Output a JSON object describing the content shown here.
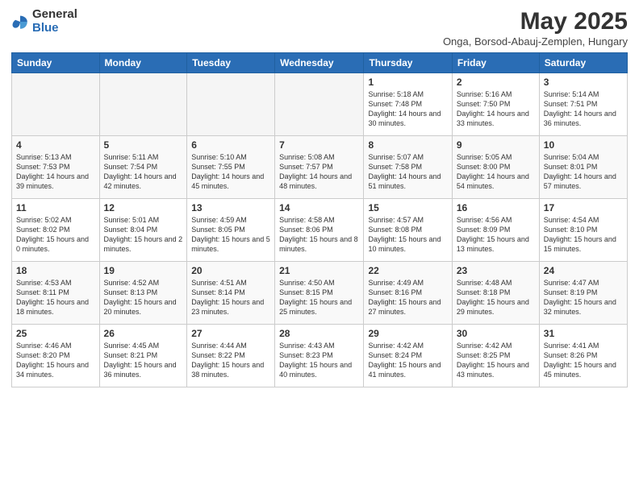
{
  "logo": {
    "general": "General",
    "blue": "Blue"
  },
  "title": "May 2025",
  "subtitle": "Onga, Borsod-Abauj-Zemplen, Hungary",
  "headers": [
    "Sunday",
    "Monday",
    "Tuesday",
    "Wednesday",
    "Thursday",
    "Friday",
    "Saturday"
  ],
  "weeks": [
    [
      {
        "day": "",
        "info": ""
      },
      {
        "day": "",
        "info": ""
      },
      {
        "day": "",
        "info": ""
      },
      {
        "day": "",
        "info": ""
      },
      {
        "day": "1",
        "info": "Sunrise: 5:18 AM\nSunset: 7:48 PM\nDaylight: 14 hours\nand 30 minutes."
      },
      {
        "day": "2",
        "info": "Sunrise: 5:16 AM\nSunset: 7:50 PM\nDaylight: 14 hours\nand 33 minutes."
      },
      {
        "day": "3",
        "info": "Sunrise: 5:14 AM\nSunset: 7:51 PM\nDaylight: 14 hours\nand 36 minutes."
      }
    ],
    [
      {
        "day": "4",
        "info": "Sunrise: 5:13 AM\nSunset: 7:53 PM\nDaylight: 14 hours\nand 39 minutes."
      },
      {
        "day": "5",
        "info": "Sunrise: 5:11 AM\nSunset: 7:54 PM\nDaylight: 14 hours\nand 42 minutes."
      },
      {
        "day": "6",
        "info": "Sunrise: 5:10 AM\nSunset: 7:55 PM\nDaylight: 14 hours\nand 45 minutes."
      },
      {
        "day": "7",
        "info": "Sunrise: 5:08 AM\nSunset: 7:57 PM\nDaylight: 14 hours\nand 48 minutes."
      },
      {
        "day": "8",
        "info": "Sunrise: 5:07 AM\nSunset: 7:58 PM\nDaylight: 14 hours\nand 51 minutes."
      },
      {
        "day": "9",
        "info": "Sunrise: 5:05 AM\nSunset: 8:00 PM\nDaylight: 14 hours\nand 54 minutes."
      },
      {
        "day": "10",
        "info": "Sunrise: 5:04 AM\nSunset: 8:01 PM\nDaylight: 14 hours\nand 57 minutes."
      }
    ],
    [
      {
        "day": "11",
        "info": "Sunrise: 5:02 AM\nSunset: 8:02 PM\nDaylight: 15 hours\nand 0 minutes."
      },
      {
        "day": "12",
        "info": "Sunrise: 5:01 AM\nSunset: 8:04 PM\nDaylight: 15 hours\nand 2 minutes."
      },
      {
        "day": "13",
        "info": "Sunrise: 4:59 AM\nSunset: 8:05 PM\nDaylight: 15 hours\nand 5 minutes."
      },
      {
        "day": "14",
        "info": "Sunrise: 4:58 AM\nSunset: 8:06 PM\nDaylight: 15 hours\nand 8 minutes."
      },
      {
        "day": "15",
        "info": "Sunrise: 4:57 AM\nSunset: 8:08 PM\nDaylight: 15 hours\nand 10 minutes."
      },
      {
        "day": "16",
        "info": "Sunrise: 4:56 AM\nSunset: 8:09 PM\nDaylight: 15 hours\nand 13 minutes."
      },
      {
        "day": "17",
        "info": "Sunrise: 4:54 AM\nSunset: 8:10 PM\nDaylight: 15 hours\nand 15 minutes."
      }
    ],
    [
      {
        "day": "18",
        "info": "Sunrise: 4:53 AM\nSunset: 8:11 PM\nDaylight: 15 hours\nand 18 minutes."
      },
      {
        "day": "19",
        "info": "Sunrise: 4:52 AM\nSunset: 8:13 PM\nDaylight: 15 hours\nand 20 minutes."
      },
      {
        "day": "20",
        "info": "Sunrise: 4:51 AM\nSunset: 8:14 PM\nDaylight: 15 hours\nand 23 minutes."
      },
      {
        "day": "21",
        "info": "Sunrise: 4:50 AM\nSunset: 8:15 PM\nDaylight: 15 hours\nand 25 minutes."
      },
      {
        "day": "22",
        "info": "Sunrise: 4:49 AM\nSunset: 8:16 PM\nDaylight: 15 hours\nand 27 minutes."
      },
      {
        "day": "23",
        "info": "Sunrise: 4:48 AM\nSunset: 8:18 PM\nDaylight: 15 hours\nand 29 minutes."
      },
      {
        "day": "24",
        "info": "Sunrise: 4:47 AM\nSunset: 8:19 PM\nDaylight: 15 hours\nand 32 minutes."
      }
    ],
    [
      {
        "day": "25",
        "info": "Sunrise: 4:46 AM\nSunset: 8:20 PM\nDaylight: 15 hours\nand 34 minutes."
      },
      {
        "day": "26",
        "info": "Sunrise: 4:45 AM\nSunset: 8:21 PM\nDaylight: 15 hours\nand 36 minutes."
      },
      {
        "day": "27",
        "info": "Sunrise: 4:44 AM\nSunset: 8:22 PM\nDaylight: 15 hours\nand 38 minutes."
      },
      {
        "day": "28",
        "info": "Sunrise: 4:43 AM\nSunset: 8:23 PM\nDaylight: 15 hours\nand 40 minutes."
      },
      {
        "day": "29",
        "info": "Sunrise: 4:42 AM\nSunset: 8:24 PM\nDaylight: 15 hours\nand 41 minutes."
      },
      {
        "day": "30",
        "info": "Sunrise: 4:42 AM\nSunset: 8:25 PM\nDaylight: 15 hours\nand 43 minutes."
      },
      {
        "day": "31",
        "info": "Sunrise: 4:41 AM\nSunset: 8:26 PM\nDaylight: 15 hours\nand 45 minutes."
      }
    ]
  ]
}
